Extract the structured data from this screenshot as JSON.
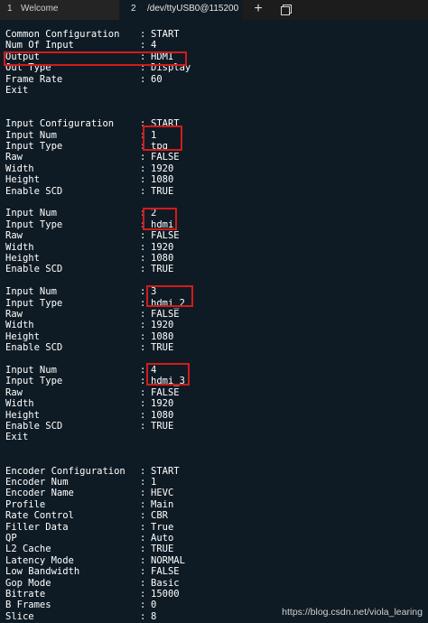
{
  "tabs": [
    {
      "num": "1",
      "label": "Welcome"
    },
    {
      "num": "2",
      "label": "/dev/ttyUSB0@115200"
    }
  ],
  "tab_actions": {
    "new_tab": "+",
    "duplicate_icon": "duplicate-window-icon"
  },
  "terminal_rows": [
    {
      "k": "Common Configuration",
      "v": "START"
    },
    {
      "k": "Num Of Input",
      "v": "4"
    },
    {
      "k": "Output",
      "v": "HDMI"
    },
    {
      "k": "Out Type",
      "v": "Display"
    },
    {
      "k": "Frame Rate",
      "v": "60"
    },
    {
      "k": "Exit",
      "v": ""
    },
    {
      "k": "",
      "v": ""
    },
    {
      "k": "",
      "v": ""
    },
    {
      "k": "Input Configuration",
      "v": "START"
    },
    {
      "k": "Input Num",
      "v": "1"
    },
    {
      "k": "Input Type",
      "v": "tpg"
    },
    {
      "k": "Raw",
      "v": "FALSE"
    },
    {
      "k": "Width",
      "v": "1920"
    },
    {
      "k": "Height",
      "v": "1080"
    },
    {
      "k": "Enable SCD",
      "v": "TRUE"
    },
    {
      "k": "",
      "v": ""
    },
    {
      "k": "Input Num",
      "v": "2"
    },
    {
      "k": "Input Type",
      "v": "hdmi"
    },
    {
      "k": "Raw",
      "v": "FALSE"
    },
    {
      "k": "Width",
      "v": "1920"
    },
    {
      "k": "Height",
      "v": "1080"
    },
    {
      "k": "Enable SCD",
      "v": "TRUE"
    },
    {
      "k": "",
      "v": ""
    },
    {
      "k": "Input Num",
      "v": "3"
    },
    {
      "k": "Input Type",
      "v": "hdmi_2"
    },
    {
      "k": "Raw",
      "v": "FALSE"
    },
    {
      "k": "Width",
      "v": "1920"
    },
    {
      "k": "Height",
      "v": "1080"
    },
    {
      "k": "Enable SCD",
      "v": "TRUE"
    },
    {
      "k": "",
      "v": ""
    },
    {
      "k": "Input Num",
      "v": "4"
    },
    {
      "k": "Input Type",
      "v": "hdmi_3"
    },
    {
      "k": "Raw",
      "v": "FALSE"
    },
    {
      "k": "Width",
      "v": "1920"
    },
    {
      "k": "Height",
      "v": "1080"
    },
    {
      "k": "Enable SCD",
      "v": "TRUE"
    },
    {
      "k": "Exit",
      "v": ""
    },
    {
      "k": "",
      "v": ""
    },
    {
      "k": "",
      "v": ""
    },
    {
      "k": "Encoder Configuration",
      "v": "START"
    },
    {
      "k": "Encoder Num",
      "v": "1"
    },
    {
      "k": "Encoder Name",
      "v": "HEVC"
    },
    {
      "k": "Profile",
      "v": "Main"
    },
    {
      "k": "Rate Control",
      "v": "CBR"
    },
    {
      "k": "Filler Data",
      "v": "True"
    },
    {
      "k": "QP",
      "v": "Auto"
    },
    {
      "k": "L2 Cache",
      "v": "TRUE"
    },
    {
      "k": "Latency Mode",
      "v": "NORMAL"
    },
    {
      "k": "Low Bandwidth",
      "v": "FALSE"
    },
    {
      "k": "Gop Mode",
      "v": "Basic"
    },
    {
      "k": "Bitrate",
      "v": "15000"
    },
    {
      "k": "B Frames",
      "v": "0"
    },
    {
      "k": "Slice",
      "v": "8"
    }
  ],
  "highlight_color": "#d31b1b",
  "watermark": "https://blog.csdn.net/viola_learing"
}
